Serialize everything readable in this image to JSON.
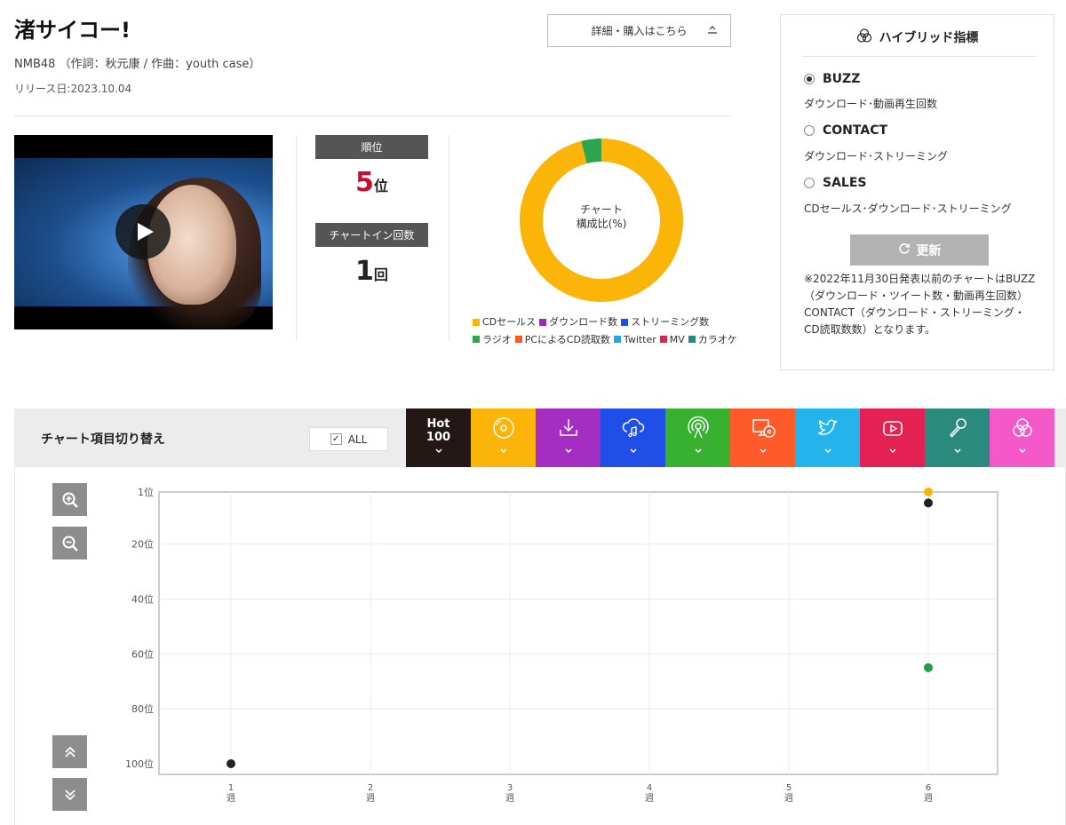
{
  "song": {
    "title": "渚サイコー!",
    "credit": "NMB48 （作詞：秋元康 / 作曲：youth case）",
    "release": "リリース日:2023.10.04"
  },
  "detail_button": {
    "label": "詳細・購入はこちら",
    "arrow": "⦣"
  },
  "rank": {
    "label": "順位",
    "value": "5",
    "unit": "位"
  },
  "chart_in": {
    "label": "チャートイン回数",
    "value": "1",
    "unit": "回"
  },
  "donut": {
    "center_line1": "チャート",
    "center_line2": "構成比(%)",
    "segments": [
      {
        "name": "CDセールス",
        "value": 96,
        "color": "#fbb508"
      },
      {
        "name": "ラジオ",
        "value": 4,
        "color": "#2ea44f"
      }
    ],
    "legend": [
      {
        "name": "CDセールス",
        "color": "#fbb508"
      },
      {
        "name": "ダウンロード数",
        "color": "#9c27b0"
      },
      {
        "name": "ストリーミング数",
        "color": "#1a4fe6"
      },
      {
        "name": "ラジオ",
        "color": "#2ea44f"
      },
      {
        "name": "PCによるCD読取数",
        "color": "#ff5722"
      },
      {
        "name": "Twitter",
        "color": "#20a7e8"
      },
      {
        "name": "MV",
        "color": "#e0204f"
      },
      {
        "name": "カラオケ",
        "color": "#26897a"
      }
    ]
  },
  "hybrid": {
    "title": "ハイブリッド指標",
    "options": [
      {
        "name": "BUZZ",
        "desc": "ダウンロード･動画再生回数",
        "selected": true
      },
      {
        "name": "CONTACT",
        "desc": "ダウンロード･ストリーミング",
        "selected": false
      },
      {
        "name": "SALES",
        "desc": "CDセールス･ダウンロード･ストリーミング",
        "selected": false
      }
    ],
    "update_label": "更新",
    "note": "※2022年11月30日発表以前のチャートはBUZZ（ダウンロード・ツイート数・動画再生回数）CONTACT（ダウンロード・ストリーミング・CD読取数数）となります。"
  },
  "tabs": {
    "title": "チャート項目切り替え",
    "all_label": "ALL",
    "hot_line1": "Hot",
    "hot_line2": "100",
    "items": [
      {
        "icon": "hot100",
        "color": "#231815"
      },
      {
        "icon": "cd-icon",
        "color": "#fbb508"
      },
      {
        "icon": "download-icon",
        "color": "#a32ec1"
      },
      {
        "icon": "streaming-icon",
        "color": "#1f4fe8"
      },
      {
        "icon": "radio-icon",
        "color": "#37b12f"
      },
      {
        "icon": "pc-cd-icon",
        "color": "#fe5a2a"
      },
      {
        "icon": "twitter-icon",
        "color": "#23b4ec"
      },
      {
        "icon": "youtube-icon",
        "color": "#e32152"
      },
      {
        "icon": "karaoke-icon",
        "color": "#2a8a7d"
      },
      {
        "icon": "hybrid-icon",
        "color": "#f558c9"
      }
    ]
  },
  "chart_data": {
    "type": "scatter",
    "x_categories": [
      "1",
      "2",
      "3",
      "4",
      "5",
      "6"
    ],
    "x_unit": "週",
    "y_ticks": [
      1,
      20,
      40,
      60,
      80,
      100
    ],
    "y_tick_unit": "位",
    "ylim": [
      1,
      100
    ],
    "y_inverted": true,
    "grid": true,
    "points": [
      {
        "x": 1,
        "y": 100,
        "color": "#222222",
        "series": "Hot 100"
      },
      {
        "x": 6,
        "y": 5,
        "color": "#222222",
        "series": "Hot 100"
      },
      {
        "x": 6,
        "y": 1,
        "color": "#fbb508",
        "series": "CDセールス"
      },
      {
        "x": 6,
        "y": 65,
        "color": "#1ea04a",
        "series": "ラジオ"
      }
    ]
  }
}
